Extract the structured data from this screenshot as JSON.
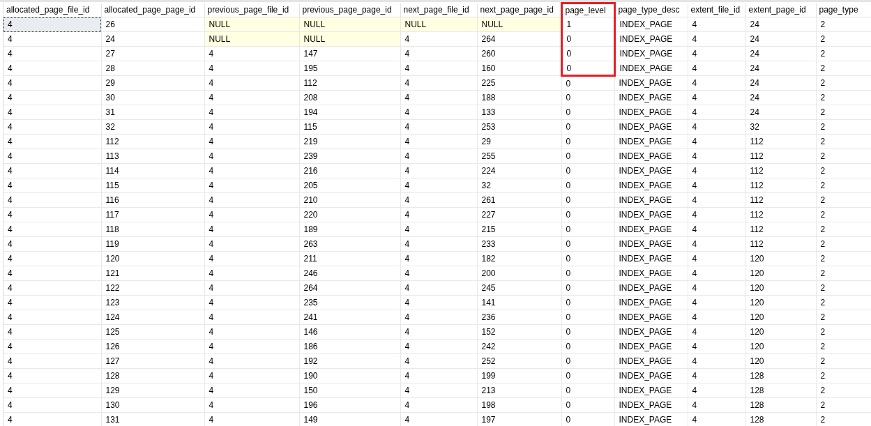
{
  "columns": [
    {
      "label": "allocated_page_file_id",
      "highlighted": false
    },
    {
      "label": "allocated_page_page_id",
      "highlighted": false
    },
    {
      "label": "previous_page_file_id",
      "highlighted": false
    },
    {
      "label": "previous_page_page_id",
      "highlighted": false
    },
    {
      "label": "next_page_file_id",
      "highlighted": false
    },
    {
      "label": "next_page_page_id",
      "highlighted": false
    },
    {
      "label": "page_level",
      "highlighted": true
    },
    {
      "label": "page_type_desc",
      "highlighted": false
    },
    {
      "label": "extent_file_id",
      "highlighted": false
    },
    {
      "label": "extent_page_id",
      "highlighted": false
    },
    {
      "label": "page_type",
      "highlighted": false
    }
  ],
  "rows": [
    {
      "selected": true,
      "highlighted": true,
      "cells": [
        "4",
        "26",
        {
          "text": "NULL",
          "null": true
        },
        {
          "text": "NULL",
          "null": true
        },
        {
          "text": "NULL",
          "null": true
        },
        {
          "text": "NULL",
          "null": true
        },
        "1",
        "INDEX_PAGE",
        "4",
        "24",
        "2"
      ]
    },
    {
      "selected": false,
      "highlighted": true,
      "cells": [
        "4",
        "24",
        {
          "text": "NULL",
          "null": true
        },
        {
          "text": "NULL",
          "null": true
        },
        "4",
        "264",
        "0",
        "INDEX_PAGE",
        "4",
        "24",
        "2"
      ]
    },
    {
      "selected": false,
      "highlighted": true,
      "cells": [
        "4",
        "27",
        "4",
        "147",
        "4",
        "260",
        "0",
        "INDEX_PAGE",
        "4",
        "24",
        "2"
      ]
    },
    {
      "selected": false,
      "highlighted": true,
      "cells": [
        "4",
        "28",
        "4",
        "195",
        "4",
        "160",
        "0",
        "INDEX_PAGE",
        "4",
        "24",
        "2"
      ]
    },
    {
      "selected": false,
      "highlighted": false,
      "cells": [
        "4",
        "29",
        "4",
        "112",
        "4",
        "225",
        "0",
        "INDEX_PAGE",
        "4",
        "24",
        "2"
      ]
    },
    {
      "selected": false,
      "highlighted": false,
      "cells": [
        "4",
        "30",
        "4",
        "208",
        "4",
        "188",
        "0",
        "INDEX_PAGE",
        "4",
        "24",
        "2"
      ]
    },
    {
      "selected": false,
      "highlighted": false,
      "cells": [
        "4",
        "31",
        "4",
        "194",
        "4",
        "133",
        "0",
        "INDEX_PAGE",
        "4",
        "24",
        "2"
      ]
    },
    {
      "selected": false,
      "highlighted": false,
      "cells": [
        "4",
        "32",
        "4",
        "115",
        "4",
        "253",
        "0",
        "INDEX_PAGE",
        "4",
        "32",
        "2"
      ]
    },
    {
      "selected": false,
      "highlighted": false,
      "cells": [
        "4",
        "112",
        "4",
        "219",
        "4",
        "29",
        "0",
        "INDEX_PAGE",
        "4",
        "112",
        "2"
      ]
    },
    {
      "selected": false,
      "highlighted": false,
      "cells": [
        "4",
        "113",
        "4",
        "239",
        "4",
        "255",
        "0",
        "INDEX_PAGE",
        "4",
        "112",
        "2"
      ]
    },
    {
      "selected": false,
      "highlighted": false,
      "cells": [
        "4",
        "114",
        "4",
        "216",
        "4",
        "224",
        "0",
        "INDEX_PAGE",
        "4",
        "112",
        "2"
      ]
    },
    {
      "selected": false,
      "highlighted": false,
      "cells": [
        "4",
        "115",
        "4",
        "205",
        "4",
        "32",
        "0",
        "INDEX_PAGE",
        "4",
        "112",
        "2"
      ]
    },
    {
      "selected": false,
      "highlighted": false,
      "cells": [
        "4",
        "116",
        "4",
        "210",
        "4",
        "261",
        "0",
        "INDEX_PAGE",
        "4",
        "112",
        "2"
      ]
    },
    {
      "selected": false,
      "highlighted": false,
      "cells": [
        "4",
        "117",
        "4",
        "220",
        "4",
        "227",
        "0",
        "INDEX_PAGE",
        "4",
        "112",
        "2"
      ]
    },
    {
      "selected": false,
      "highlighted": false,
      "cells": [
        "4",
        "118",
        "4",
        "189",
        "4",
        "215",
        "0",
        "INDEX_PAGE",
        "4",
        "112",
        "2"
      ]
    },
    {
      "selected": false,
      "highlighted": false,
      "cells": [
        "4",
        "119",
        "4",
        "263",
        "4",
        "233",
        "0",
        "INDEX_PAGE",
        "4",
        "112",
        "2"
      ]
    },
    {
      "selected": false,
      "highlighted": false,
      "cells": [
        "4",
        "120",
        "4",
        "211",
        "4",
        "182",
        "0",
        "INDEX_PAGE",
        "4",
        "120",
        "2"
      ]
    },
    {
      "selected": false,
      "highlighted": false,
      "cells": [
        "4",
        "121",
        "4",
        "246",
        "4",
        "200",
        "0",
        "INDEX_PAGE",
        "4",
        "120",
        "2"
      ]
    },
    {
      "selected": false,
      "highlighted": false,
      "cells": [
        "4",
        "122",
        "4",
        "264",
        "4",
        "245",
        "0",
        "INDEX_PAGE",
        "4",
        "120",
        "2"
      ]
    },
    {
      "selected": false,
      "highlighted": false,
      "cells": [
        "4",
        "123",
        "4",
        "235",
        "4",
        "141",
        "0",
        "INDEX_PAGE",
        "4",
        "120",
        "2"
      ]
    },
    {
      "selected": false,
      "highlighted": false,
      "cells": [
        "4",
        "124",
        "4",
        "241",
        "4",
        "236",
        "0",
        "INDEX_PAGE",
        "4",
        "120",
        "2"
      ]
    },
    {
      "selected": false,
      "highlighted": false,
      "cells": [
        "4",
        "125",
        "4",
        "146",
        "4",
        "152",
        "0",
        "INDEX_PAGE",
        "4",
        "120",
        "2"
      ]
    },
    {
      "selected": false,
      "highlighted": false,
      "cells": [
        "4",
        "126",
        "4",
        "186",
        "4",
        "242",
        "0",
        "INDEX_PAGE",
        "4",
        "120",
        "2"
      ]
    },
    {
      "selected": false,
      "highlighted": false,
      "cells": [
        "4",
        "127",
        "4",
        "192",
        "4",
        "252",
        "0",
        "INDEX_PAGE",
        "4",
        "120",
        "2"
      ]
    },
    {
      "selected": false,
      "highlighted": false,
      "cells": [
        "4",
        "128",
        "4",
        "190",
        "4",
        "199",
        "0",
        "INDEX_PAGE",
        "4",
        "128",
        "2"
      ]
    },
    {
      "selected": false,
      "highlighted": false,
      "cells": [
        "4",
        "129",
        "4",
        "150",
        "4",
        "213",
        "0",
        "INDEX_PAGE",
        "4",
        "128",
        "2"
      ]
    },
    {
      "selected": false,
      "highlighted": false,
      "cells": [
        "4",
        "130",
        "4",
        "196",
        "4",
        "198",
        "0",
        "INDEX_PAGE",
        "4",
        "128",
        "2"
      ]
    },
    {
      "selected": false,
      "highlighted": false,
      "cells": [
        "4",
        "131",
        "4",
        "149",
        "4",
        "197",
        "0",
        "INDEX_PAGE",
        "4",
        "128",
        "2"
      ]
    }
  ]
}
